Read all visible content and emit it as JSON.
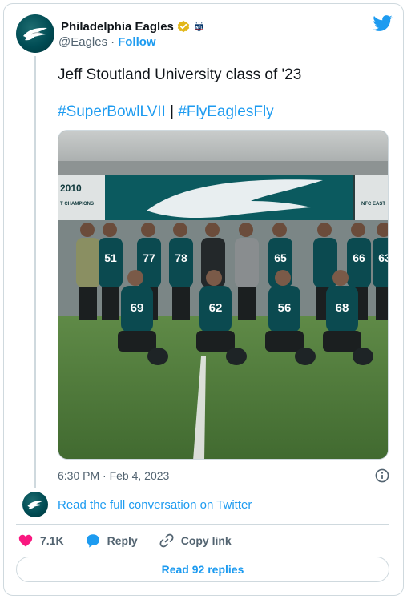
{
  "author": {
    "display_name": "Philadelphia Eagles",
    "handle": "@Eagles",
    "separator": "·",
    "follow_label": "Follow"
  },
  "tweet": {
    "text": "Jeff Stoutland University class of '23",
    "hashtag_1": "#SuperBowlLVII",
    "hashtag_sep": " | ",
    "hashtag_2": "#FlyEaglesFly",
    "timestamp": "6:30 PM · Feb 4, 2023"
  },
  "media": {
    "banner_left_year": "2010",
    "banner_left_text": "T CHAMPIONS",
    "banner_right_text": "NFC EAST",
    "jersey_numbers": [
      "51",
      "77",
      "78",
      "65",
      "63",
      "56",
      "68",
      "62",
      "69",
      "66"
    ]
  },
  "conversation_link": "Read the full conversation on Twitter",
  "actions": {
    "likes": "7.1K",
    "reply_label": "Reply",
    "copy_label": "Copy link"
  },
  "read_replies_label": "Read 92 replies",
  "icons": {
    "verified": "verified-badge-icon",
    "league": "nfl-shield-icon",
    "bird": "twitter-bird-icon",
    "info": "info-icon",
    "heart": "heart-icon",
    "reply": "reply-bubble-icon",
    "copy": "link-icon"
  },
  "colors": {
    "accent": "#1d9bf0",
    "heart": "#f91880",
    "verified": "#e2b719",
    "eagles_green": "#004c54"
  }
}
